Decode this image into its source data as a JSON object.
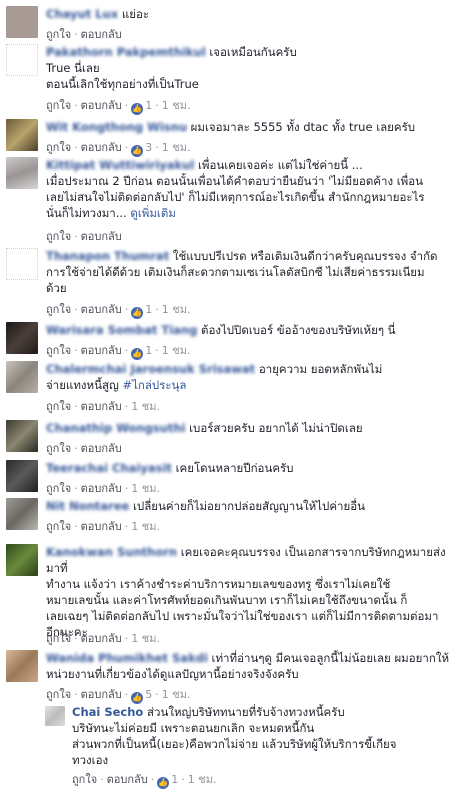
{
  "actions": {
    "like": "ถูกใจ",
    "reply": "ตอบกลับ",
    "dot": "·"
  },
  "comments": [
    {
      "name": "Chayut Lux",
      "text": "แย่อะ",
      "count": "",
      "time": "",
      "avatar_color": "#a89a94"
    },
    {
      "name": "Pakathorn Pakpemthikul",
      "text": "เจอเหมือนกันครับ",
      "text2": "True นี่เลย",
      "text3": "ตอนนี้เลิกใช้ทุกอย่างที่เป็นTrue",
      "count": "1",
      "time": "1 ชม.",
      "avatar_color": "#ffffff"
    },
    {
      "name": "Wit Kongthong Wisnu",
      "text": "ผมเจอมาละ 5555 ทั้ง dtac ทั้ง true เลยครับ",
      "count": "3",
      "time": "1 ชม.",
      "avatar_color": "#7a6a4a"
    },
    {
      "name": "Kittipat Wuttiwiriyakul",
      "text": "เพื่อนเคยเจอค่ะ แต่ไม่ใช่ค่ายนี้ ...",
      "text2": "เมื่อประมาณ 2 ปีก่อน ตอนนั้นเพื่อนได้คำตอบว่ายืนยันว่า 'ไม่มียอดค้าง เพื่อน",
      "text3": "เลยไม่สนใจไม่ติดต่อกลับไป' ก็ไม่มีเหตุการณ์อะไรเกิดขึ้น สำนักกฎหมายอะไร",
      "text4": "นั่นก็ไม่ทวงมา...",
      "more": "ดูเพิ่มเติม",
      "count": "",
      "time": "",
      "avatar_color": "#b9b4b4"
    },
    {
      "name": "Thanapon Thumrat",
      "text": "ใช้แบบปรีเปรด หรือเติมเงินดีกว่าครับคุณบรรจง จำกัด",
      "text2": "การใช้จ่ายได้ดีด้วย เติมเงินก็สะดวกตามเซเว่นโลตัสบิกซี ไม่เสียค่าธรรมเนียม",
      "text3": "ด้วย",
      "count": "1",
      "time": "1 ชม.",
      "avatar_color": "#ffffff"
    },
    {
      "name": "Warisara Sombat Tiang",
      "text": "ต้องไปปิดเบอร์ ข้ออ้างของบริษัทเห้ยๆ นี่",
      "count": "1",
      "time": "1 ชม.",
      "avatar_color": "#2a2422"
    },
    {
      "name": "Chalermchai Jaroensuk Srisawat",
      "text": "อายุความ ยอดหลักพันไม่",
      "text2": "จ่ายแทงหนี้สูญ",
      "hashtag": "#ไกล่ประนุล",
      "count": "",
      "time": "1 ชม.",
      "avatar_color": "#a6a29a"
    },
    {
      "name": "Chanathip Wongsuthi",
      "text": "เบอร์สวยครับ อยากได้ ไม่น่าปิดเลย",
      "count": "",
      "time": "",
      "avatar_color": "#4a4a3e"
    },
    {
      "name": "Teerachai Chaiyasit",
      "text": "เคยโดนหลายปีก่อนครับ",
      "count": "",
      "time": "1 ชม.",
      "avatar_color": "#3a3a3a"
    },
    {
      "name": "Nit Nontaree",
      "text": "เปลี่ยนค่ายก็ไม่อยากปล่อยสัญญานให้ไปค่ายอื่น",
      "count": "",
      "time": "1 ชม.",
      "avatar_color": "#8a8682"
    },
    {
      "name": "Kanokwan Sunthorn",
      "text": "เคยเจอคะคุณบรรจง เป็นเอกสารจากบริษัทกฎหมายส่งมาที่",
      "text2": "ทำงาน แจ้งว่า เราค้างชำระค่าบริการหมายเลขของทรู ซึ่งเราไม่เคยใช้",
      "text3": "หมายเลขนั้น และค่าโทรศัพท์ยอดเกินพันบาท เราก็ไม่เคยใช้ถึงขนาดนั้น ก็",
      "text4": "เลยเฉยๆ ไม่ติดต่อกลับไป เพราะมั่นใจว่าไม่ใช่ของเรา แต่ก็ไม่มีการติดตามต่อมา",
      "text5": "อีกนะคะ",
      "count": "",
      "time": "1 ชม.",
      "avatar_color": "#3f5a2c"
    },
    {
      "name": "Wanida Phumikhet Sakdi",
      "text": "เท่าที่อ่านๆดู มีคนเจอลูกนี้ไม่น้อยเลย ผมอยากให้",
      "text2": "หน่วยงานที่เกี่ยวข้องได้ดูแลปัญหานี้อย่างจริงจังครับ",
      "count": "5",
      "time": "1 ชม.",
      "avatar_color": "#c2a58a"
    }
  ],
  "reply": {
    "name": "Chai Secho",
    "text": "ส่วนใหญ่บริษัททนายที่รับจ้างทวงหนี้ครับ",
    "text2": "บริษัทนะไม่ค่อยมี เพราะตอนยกเลิก จะหมดหนี้กัน",
    "text3": "ส่วนพวกที่เป็นหนี้(เยอะ)คือพวกไม่จ่าย แล้วบริษัทผู้ให้บริการขี้เกียจ",
    "text4": "ทวงเอง",
    "count": "1",
    "time": "1 ชม.",
    "avatar_color": "#d8d8d8"
  }
}
